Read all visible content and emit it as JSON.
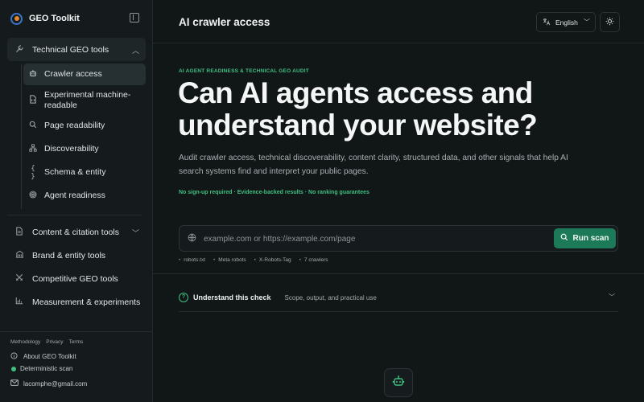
{
  "sidebar": {
    "brand": "GEO Toolkit",
    "groups": [
      {
        "label": "Technical GEO tools",
        "icon": "wrench-icon"
      },
      {
        "label": "Content & citation tools",
        "icon": "document-icon"
      },
      {
        "label": "Brand & entity tools",
        "icon": "building-icon"
      },
      {
        "label": "Competitive GEO tools",
        "icon": "swords-icon"
      },
      {
        "label": "Measurement & experiments",
        "icon": "bar-chart-icon"
      }
    ],
    "sub_items": [
      {
        "label": "Crawler access",
        "icon": "robot-icon"
      },
      {
        "label": "Experimental machine-readable",
        "icon": "file-code-icon"
      },
      {
        "label": "Page readability",
        "icon": "search-icon"
      },
      {
        "label": "Discoverability",
        "icon": "network-icon"
      },
      {
        "label": "Schema & entity",
        "icon": "braces-icon"
      },
      {
        "label": "Agent readiness",
        "icon": "fingerprint-icon"
      }
    ],
    "footer": {
      "links": [
        "Methodology",
        "Privacy",
        "Terms"
      ],
      "about": "About GEO Toolkit",
      "status": "Deterministic scan",
      "email": "lacomphe@gmail.com"
    }
  },
  "header": {
    "title": "AI crawler access",
    "language": "English"
  },
  "main": {
    "eyebrow": "AI AGENT READINESS & TECHNICAL GEO AUDIT",
    "headline": "Can AI agents access and understand your website?",
    "description": "Audit crawler access, technical discoverability, content clarity, structured data, and other signals that help AI search systems find and interpret your public pages.",
    "tagline": "No sign-up required · Evidence-backed results · No ranking guarantees",
    "search": {
      "placeholder": "example.com or https://example.com/page",
      "value": "",
      "button": "Run scan"
    },
    "chips": [
      "robots.txt",
      "Meta robots",
      "X-Robots-Tag",
      "7 crawlers"
    ],
    "accordion": {
      "title": "Understand this check",
      "description": "Scope, output, and practical use"
    }
  },
  "colors": {
    "accent": "#3fbf82",
    "button": "#1d7a58",
    "background": "#111617",
    "sidebar": "#151b1c"
  }
}
